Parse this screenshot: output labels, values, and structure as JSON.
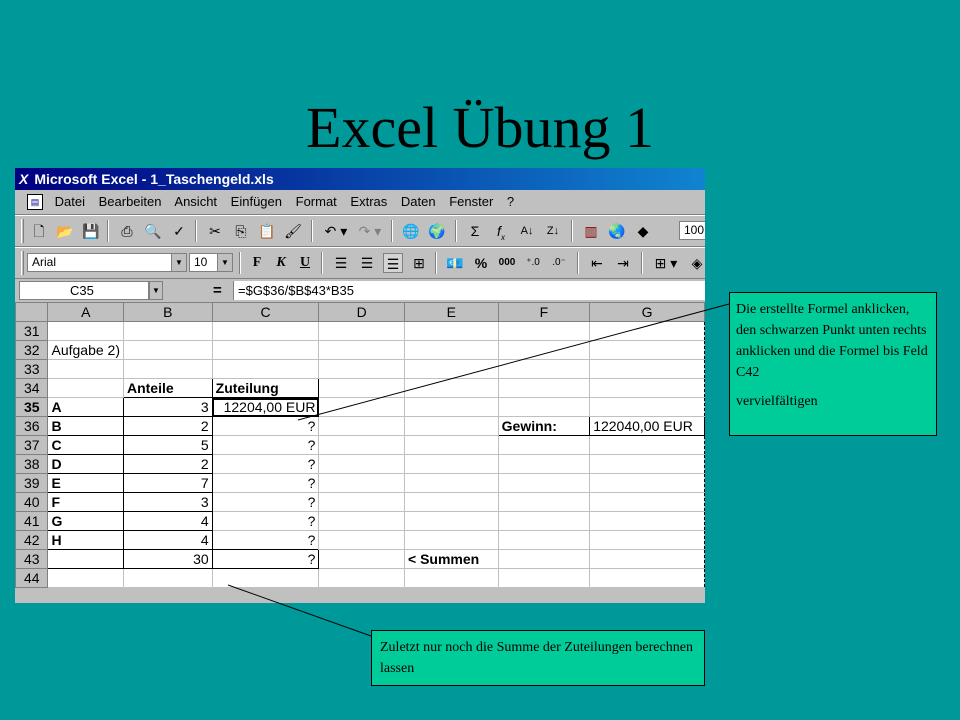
{
  "slide": {
    "title": "Excel Übung 1"
  },
  "window": {
    "title": "Microsoft Excel - 1_Taschengeld.xls",
    "app_icon": "excel-x-icon"
  },
  "menu": {
    "items": [
      "Datei",
      "Bearbeiten",
      "Ansicht",
      "Einfügen",
      "Format",
      "Extras",
      "Daten",
      "Fenster",
      "?"
    ]
  },
  "toolbar_standard": {
    "zoom_value": "100"
  },
  "toolbar_format": {
    "font_name": "Arial",
    "font_size": "10",
    "bold_label": "F",
    "italic_label": "K",
    "underline_label": "U",
    "percent_label": "%",
    "thousands_label": "000"
  },
  "formula_bar": {
    "name_box": "C35",
    "equals": "=",
    "formula": "=$G$36/$B$43*B35"
  },
  "sheet": {
    "columns": [
      "A",
      "B",
      "C",
      "D",
      "E",
      "F",
      "G"
    ],
    "rows": [
      {
        "n": "31",
        "A": "",
        "B": "",
        "C": "",
        "D": "",
        "E": "",
        "F": "",
        "G": ""
      },
      {
        "n": "32",
        "A": "Aufgabe 2)",
        "B": "",
        "C": "",
        "D": "",
        "E": "",
        "F": "",
        "G": ""
      },
      {
        "n": "33",
        "A": "",
        "B": "",
        "C": "",
        "D": "",
        "E": "",
        "F": "",
        "G": ""
      },
      {
        "n": "34",
        "A": "",
        "B": "Anteile",
        "C": "Zuteilung",
        "D": "",
        "E": "",
        "F": "",
        "G": ""
      },
      {
        "n": "35",
        "A": "A",
        "B": "3",
        "C": "12204,00 EUR",
        "D": "",
        "E": "",
        "F": "",
        "G": ""
      },
      {
        "n": "36",
        "A": "B",
        "B": "2",
        "C": "?",
        "D": "",
        "E": "",
        "F": "Gewinn:",
        "G": "122040,00 EUR"
      },
      {
        "n": "37",
        "A": "C",
        "B": "5",
        "C": "?",
        "D": "",
        "E": "",
        "F": "",
        "G": ""
      },
      {
        "n": "38",
        "A": "D",
        "B": "2",
        "C": "?",
        "D": "",
        "E": "",
        "F": "",
        "G": ""
      },
      {
        "n": "39",
        "A": "E",
        "B": "7",
        "C": "?",
        "D": "",
        "E": "",
        "F": "",
        "G": ""
      },
      {
        "n": "40",
        "A": "F",
        "B": "3",
        "C": "?",
        "D": "",
        "E": "",
        "F": "",
        "G": ""
      },
      {
        "n": "41",
        "A": "G",
        "B": "4",
        "C": "?",
        "D": "",
        "E": "",
        "F": "",
        "G": ""
      },
      {
        "n": "42",
        "A": "H",
        "B": "4",
        "C": "?",
        "D": "",
        "E": "",
        "F": "",
        "G": ""
      },
      {
        "n": "43",
        "A": "",
        "B": "30",
        "C": "?",
        "D": "",
        "E": "< Summen",
        "F": "",
        "G": ""
      },
      {
        "n": "44",
        "A": "",
        "B": "",
        "C": "",
        "D": "",
        "E": "",
        "F": "",
        "G": ""
      }
    ]
  },
  "callouts": {
    "formula_hint": "Die erstellte Formel anklicken, den schwarzen Punkt unten rechts anklicken und die Formel bis Feld C42",
    "formula_hint_2": "vervielfältigen",
    "sum_hint": "Zuletzt nur noch die Summe der Zuteilungen berechnen lassen"
  }
}
